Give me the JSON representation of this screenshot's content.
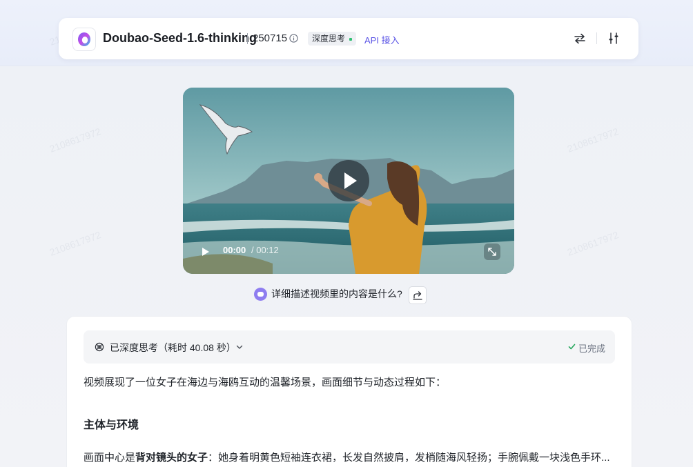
{
  "header": {
    "model_name": "Doubao-Seed-1.6-thinking",
    "version": "250715",
    "think_badge": "深度思考",
    "api_link": "API 接入"
  },
  "watermark": "2108617972",
  "video": {
    "current_time": "00:00",
    "total_time": "/ 00:12"
  },
  "question": {
    "text": "详细描述视频里的内容是什么?"
  },
  "answer": {
    "think_label": "已深度思考（耗时 40.08 秒）",
    "status": "已完成",
    "intro": "视频展现了一位女子在海边与海鸥互动的温馨场景，画面细节与动态过程如下：",
    "section_title": "主体与环境",
    "para_prefix": "画面中心是",
    "para_bold": "背对镜头的女子",
    "para_rest": "：她身着明黄色短袖连衣裙，长发自然披肩，发梢随海风轻扬；手腕佩戴一块浅色手环..."
  },
  "colors": {
    "accent": "#5b55e6",
    "success": "#2fbf71",
    "dress": "#d89a2e"
  }
}
